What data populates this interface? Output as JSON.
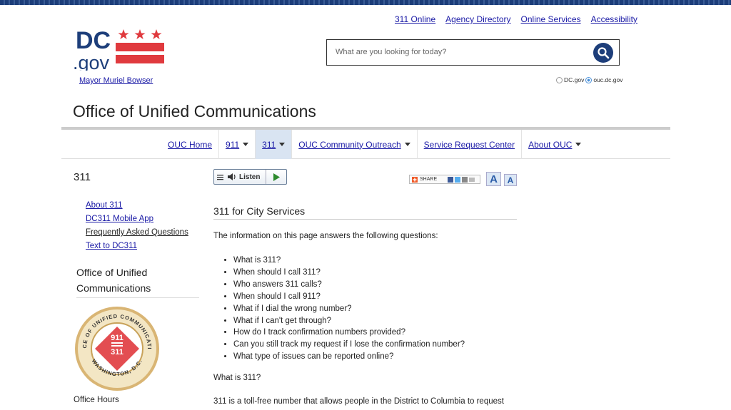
{
  "header": {
    "top_links": [
      "311 Online",
      "Agency Directory",
      "Online Services",
      "Accessibility"
    ],
    "logo_text_dc": "DC",
    "logo_text_gov": ".gov",
    "mayor_link": "Mayor Muriel Bowser",
    "search_placeholder": "What are you looking for today?",
    "radio_dcgov": "DC.gov",
    "radio_agency": "ouc.dc.gov"
  },
  "page_title": "Office of Unified Communications",
  "nav": {
    "items": [
      {
        "label": "OUC Home"
      },
      {
        "label": "911"
      },
      {
        "label": "311"
      },
      {
        "label": "OUC Community Outreach"
      },
      {
        "label": "Service Request Center"
      },
      {
        "label": "About OUC"
      }
    ]
  },
  "sidebar": {
    "heading": "311",
    "links": [
      "About 311",
      "DC311 Mobile App",
      "Frequently Asked Questions",
      "Text to DC311"
    ],
    "org_name": "Office of Unified Communications",
    "seal": {
      "ring_text": "OFFICE OF UNIFIED COMMUNICATIONS",
      "bottom_text": "WASHINGTON, D.C.",
      "center_top": "911",
      "center_bottom": "311"
    },
    "office_hours": "Office Hours"
  },
  "toolbar": {
    "listen_label": "Listen",
    "share_label": "SHARE",
    "text_large": "A",
    "text_small": "A"
  },
  "content": {
    "heading": "311 for City Services",
    "intro": "The information on this page answers the following questions:",
    "questions": [
      "What is 311?",
      "When should I call 311?",
      "Who answers 311 calls?",
      "When should I call 911?",
      "What if I dial the wrong number?",
      "What if I can't get through?",
      "How do I track confirmation numbers provided?",
      "Can you still track my request if I lose the confirmation number?",
      "What type of issues can be reported online?"
    ],
    "section_heading": "What is 311?",
    "paragraph": "311 is a toll-free number that allows people in the District to Columbia to request"
  },
  "colors": {
    "brand_red": "#e03a3e",
    "brand_navy": "#1d3e7a",
    "link": "#1a1aa6"
  }
}
